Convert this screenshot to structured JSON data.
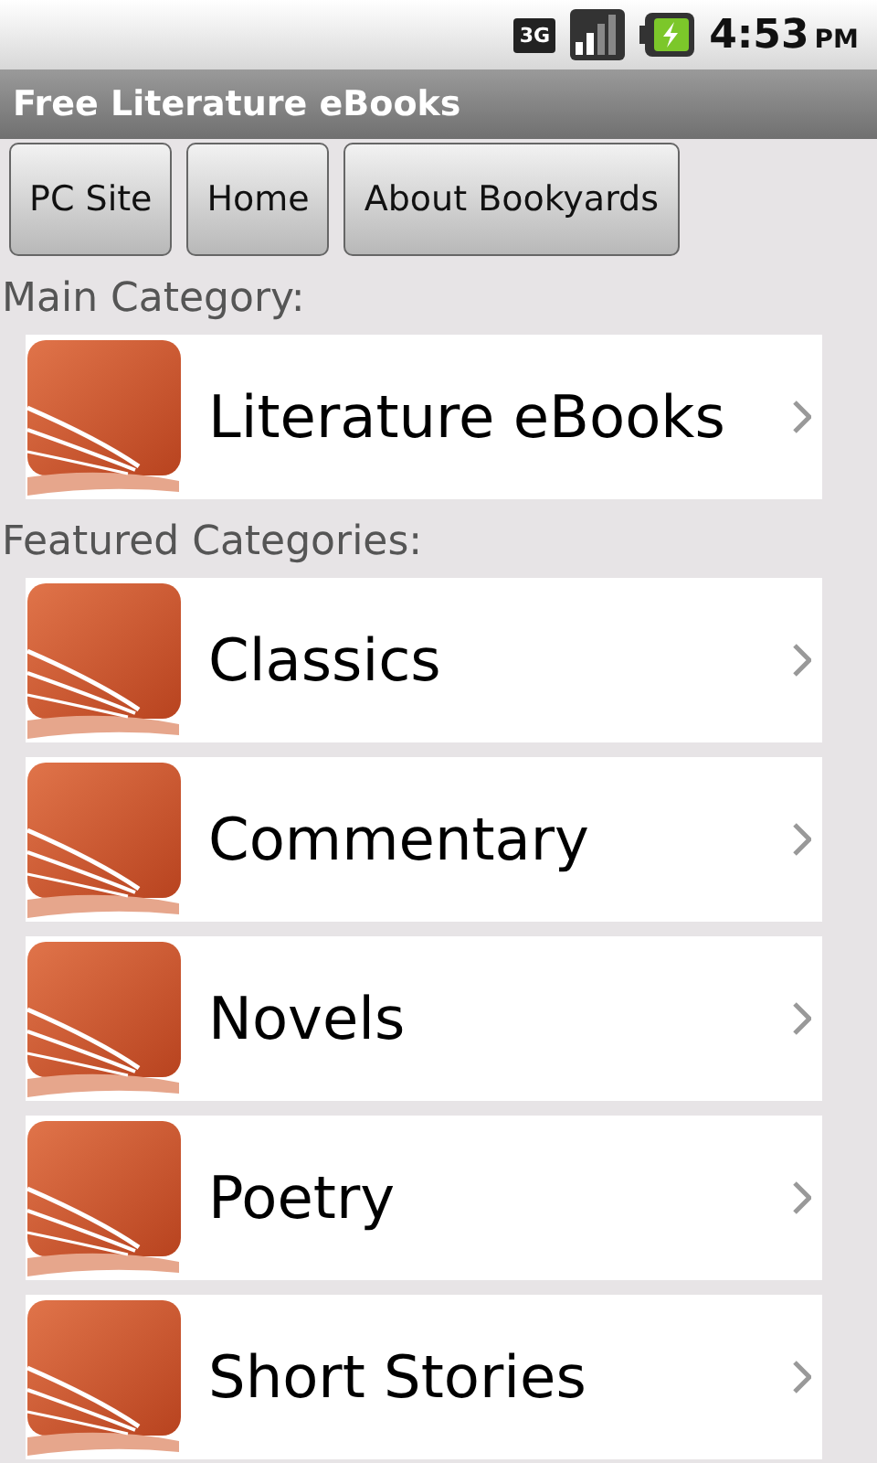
{
  "status_bar": {
    "network": "3G",
    "time": "4:53",
    "meridiem": "PM"
  },
  "title_bar": {
    "title": "Free Literature eBooks"
  },
  "nav_buttons": [
    "PC Site",
    "Home",
    "About Bookyards"
  ],
  "sections": [
    {
      "heading": "Main Category:",
      "items": [
        {
          "label": "Literature eBooks"
        }
      ]
    },
    {
      "heading": "Featured Categories:",
      "items": [
        {
          "label": "Classics"
        },
        {
          "label": "Commentary"
        },
        {
          "label": "Novels"
        },
        {
          "label": "Poetry"
        },
        {
          "label": "Short Stories"
        }
      ]
    }
  ]
}
